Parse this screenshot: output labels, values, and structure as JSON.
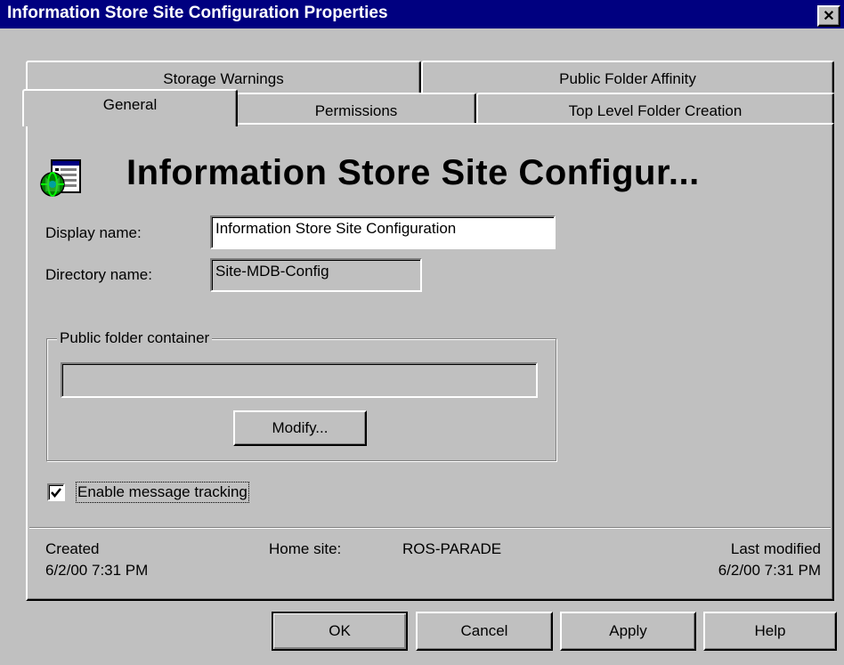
{
  "window": {
    "title": "Information Store Site Configuration Properties"
  },
  "tabs": {
    "back_row": [
      "Storage Warnings",
      "Public Folder Affinity"
    ],
    "front_row": [
      "General",
      "Permissions",
      "Top Level Folder Creation"
    ],
    "active": "General"
  },
  "general": {
    "heading": "Information Store Site Configur...",
    "icon": "information-store-icon",
    "display_name": {
      "label": "Display name:",
      "value": "Information Store Site Configuration"
    },
    "directory_name": {
      "label": "Directory name:",
      "value": "Site-MDB-Config"
    },
    "public_folder": {
      "group_label": "Public folder container",
      "value": "",
      "modify_label": "Modify..."
    },
    "tracking": {
      "label": "Enable message tracking",
      "checked": true
    },
    "created": {
      "label": "Created",
      "value": "6/2/00  7:31 PM"
    },
    "home_site": {
      "label": "Home site:",
      "value": "ROS-PARADE"
    },
    "last_modified": {
      "label": "Last modified",
      "value": "6/2/00  7:31 PM"
    }
  },
  "buttons": {
    "ok": "OK",
    "cancel": "Cancel",
    "apply": "Apply",
    "help": "Help"
  }
}
